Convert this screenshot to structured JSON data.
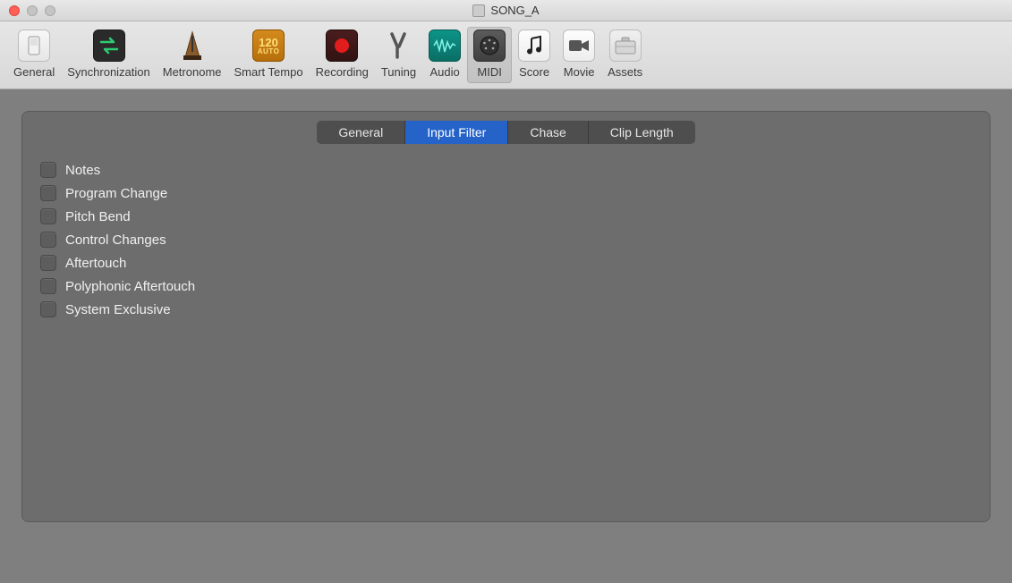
{
  "window": {
    "title": "SONG_A"
  },
  "toolbar": {
    "items": [
      {
        "id": "general",
        "label": "General"
      },
      {
        "id": "synchronization",
        "label": "Synchronization"
      },
      {
        "id": "metronome",
        "label": "Metronome"
      },
      {
        "id": "smart-tempo",
        "label": "Smart Tempo",
        "badge": "120",
        "sub": "AUTO"
      },
      {
        "id": "recording",
        "label": "Recording"
      },
      {
        "id": "tuning",
        "label": "Tuning"
      },
      {
        "id": "audio",
        "label": "Audio"
      },
      {
        "id": "midi",
        "label": "MIDI",
        "active": true
      },
      {
        "id": "score",
        "label": "Score"
      },
      {
        "id": "movie",
        "label": "Movie"
      },
      {
        "id": "assets",
        "label": "Assets"
      }
    ]
  },
  "tabs": [
    {
      "id": "general",
      "label": "General",
      "active": false
    },
    {
      "id": "input-filter",
      "label": "Input Filter",
      "active": true
    },
    {
      "id": "chase",
      "label": "Chase",
      "active": false
    },
    {
      "id": "clip-length",
      "label": "Clip Length",
      "active": false
    }
  ],
  "filters": [
    {
      "id": "notes",
      "label": "Notes",
      "checked": false
    },
    {
      "id": "program-change",
      "label": "Program Change",
      "checked": false
    },
    {
      "id": "pitch-bend",
      "label": "Pitch Bend",
      "checked": false
    },
    {
      "id": "control-changes",
      "label": "Control Changes",
      "checked": false
    },
    {
      "id": "aftertouch",
      "label": "Aftertouch",
      "checked": false
    },
    {
      "id": "polyphonic-aftertouch",
      "label": "Polyphonic Aftertouch",
      "checked": false
    },
    {
      "id": "system-exclusive",
      "label": "System Exclusive",
      "checked": false
    }
  ]
}
